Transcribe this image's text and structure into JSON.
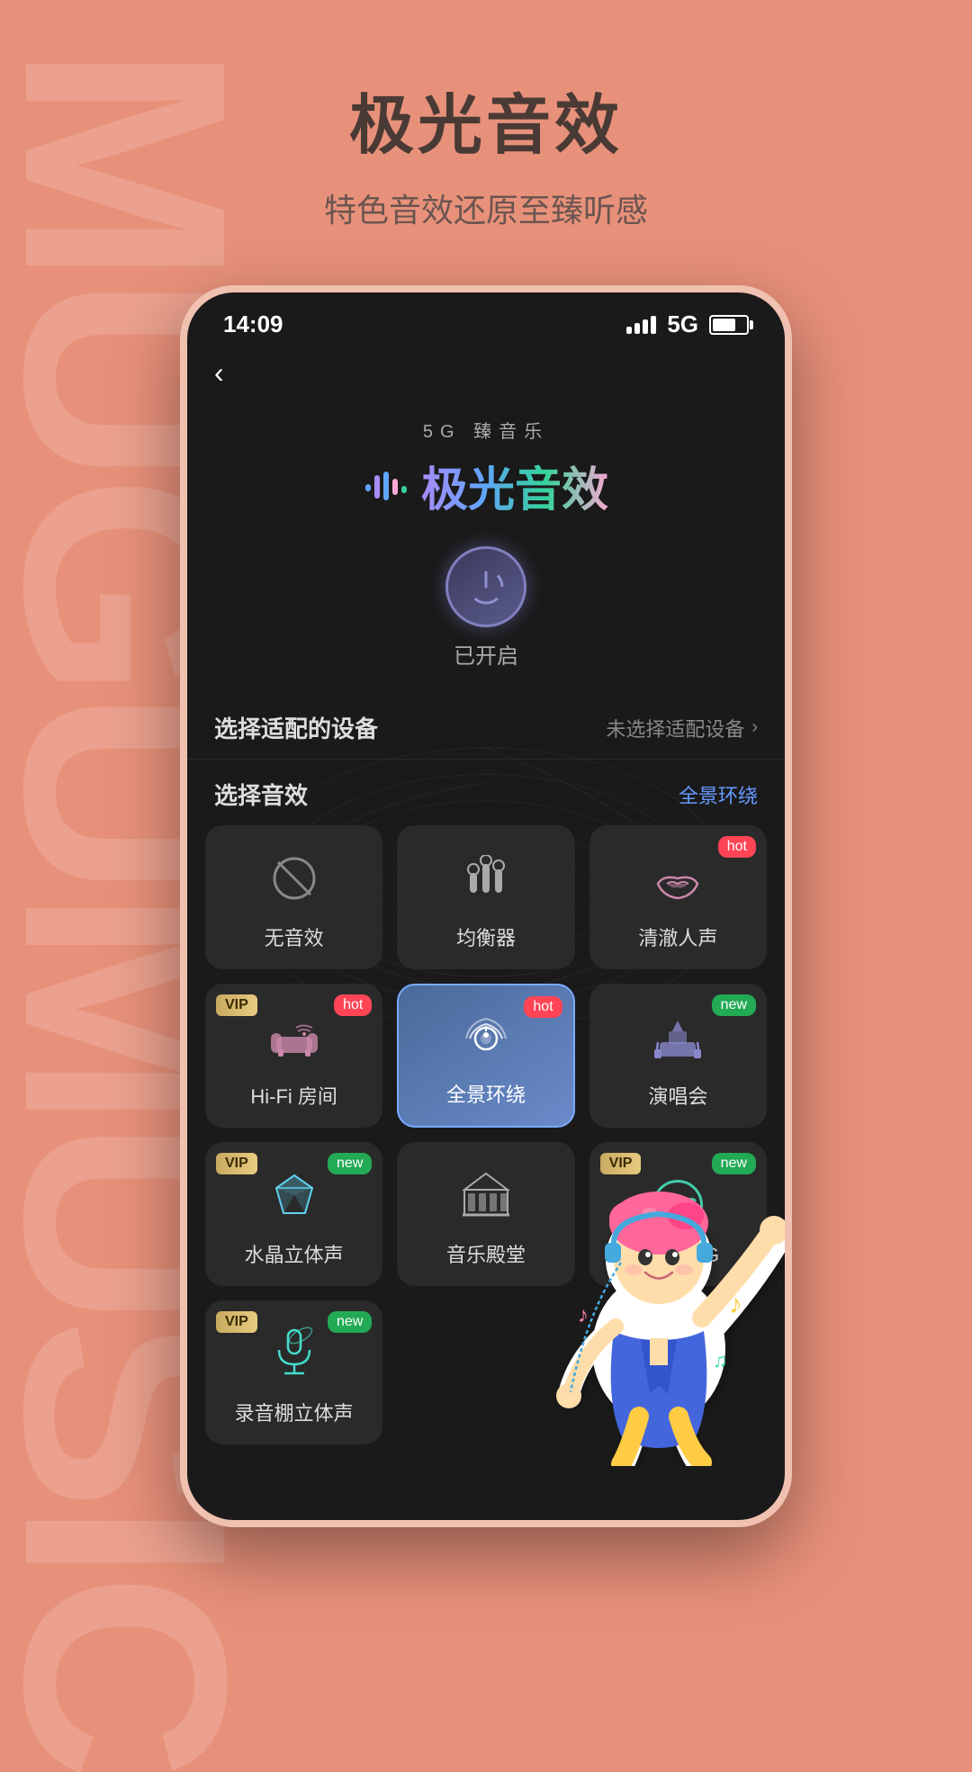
{
  "background_color": "#E8917A",
  "watermark_text": "MUGUMUSIC",
  "header": {
    "title": "极光音效",
    "subtitle": "特色音效还原至臻听感"
  },
  "status_bar": {
    "time": "14:09",
    "signal": "5G",
    "battery_percent": 70
  },
  "logo": {
    "tag": "5G 臻音乐",
    "name": "极光音效"
  },
  "power": {
    "status": "已开启"
  },
  "device_section": {
    "label": "选择适配的设备",
    "action": "未选择适配设备",
    "has_chevron": true
  },
  "effects_section": {
    "label": "选择音效",
    "action": "全景环绕",
    "cards": [
      {
        "id": "no-effect",
        "name": "无音效",
        "icon": "⊘",
        "icon_type": "no-effect",
        "active": false,
        "vip": false,
        "badge": null
      },
      {
        "id": "equalizer",
        "name": "均衡器",
        "icon": "🎚",
        "icon_type": "equalizer",
        "active": false,
        "vip": false,
        "badge": null
      },
      {
        "id": "clear-voice",
        "name": "清澈人声",
        "icon": "👄",
        "icon_type": "lips",
        "active": false,
        "vip": false,
        "badge": "hot"
      },
      {
        "id": "hifi-room",
        "name": "Hi-Fi 房间",
        "icon": "🛋",
        "icon_type": "sofa",
        "active": false,
        "vip": true,
        "badge": "hot"
      },
      {
        "id": "panoramic",
        "name": "全景环绕",
        "icon": "🎧",
        "icon_type": "surround",
        "active": true,
        "vip": false,
        "badge": "hot"
      },
      {
        "id": "concert",
        "name": "演唱会",
        "icon": "🎪",
        "icon_type": "concert",
        "active": false,
        "vip": false,
        "badge": "new"
      },
      {
        "id": "crystal",
        "name": "水晶立体声",
        "icon": "💎",
        "icon_type": "diamond",
        "active": false,
        "vip": true,
        "badge": "new"
      },
      {
        "id": "music-temple",
        "name": "音乐殿堂",
        "icon": "🏛",
        "icon_type": "temple",
        "active": false,
        "vip": false,
        "badge": null
      },
      {
        "id": "pure-acg",
        "name": "纯净ACG",
        "icon": "ACG",
        "icon_type": "acg",
        "active": false,
        "vip": true,
        "badge": "new"
      },
      {
        "id": "studio",
        "name": "录音棚立体声",
        "icon": "🎙",
        "icon_type": "mic",
        "active": false,
        "vip": true,
        "badge": "new"
      }
    ]
  }
}
